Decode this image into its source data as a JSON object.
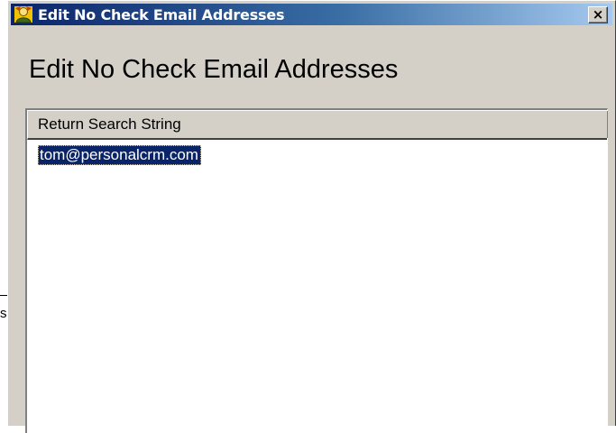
{
  "window": {
    "title": "Edit No Check Email Addresses",
    "close_glyph": "×",
    "icon": "app-icon"
  },
  "background": {
    "partial_text": "s"
  },
  "page": {
    "heading": "Edit No Check Email Addresses"
  },
  "list": {
    "column_header": "Return Search String",
    "rows": [
      "tom@personalcrm.com"
    ],
    "selected_index": 0
  },
  "colors": {
    "title_gradient_start": "#0a246a",
    "title_gradient_end": "#a6caf0",
    "selection": "#0a246a",
    "face": "#d4d0c8"
  }
}
